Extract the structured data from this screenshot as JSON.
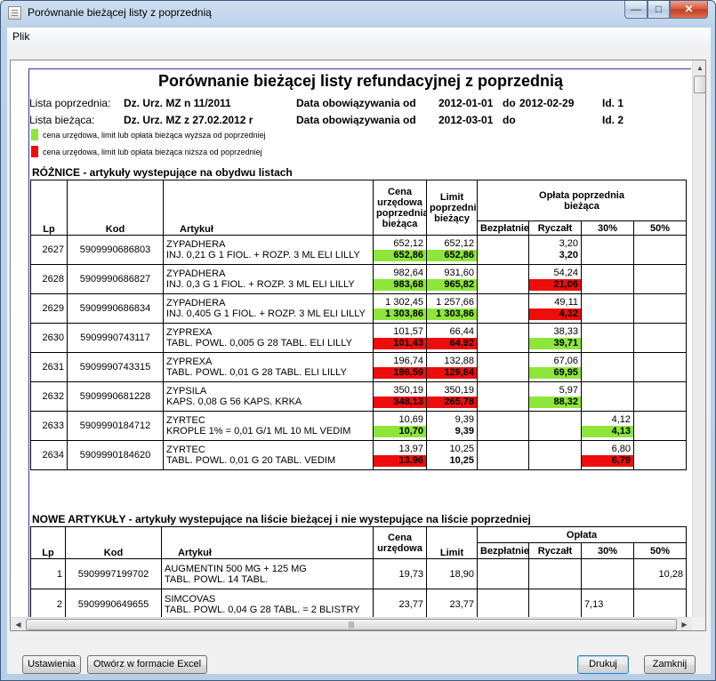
{
  "window": {
    "title": "Porównanie bieżącej listy z poprzednią"
  },
  "menu": {
    "file": "Plik"
  },
  "report": {
    "title": "Porównanie bieżącej listy refundacyjnej z poprzednią",
    "prev": {
      "label": "Lista poprzednia:",
      "name": "Dz. Urz. MZ n 11/2011",
      "validity_label": "Data obowiązywania od",
      "from": "2012-01-01",
      "to_label": "do",
      "to": "2012-02-29",
      "id": "Id. 1"
    },
    "curr": {
      "label": "Lista bieżąca:",
      "name": "Dz. Urz. MZ z 27.02.2012 r",
      "validity_label": "Data obowiązywania od",
      "from": "2012-03-01",
      "to_label": "do",
      "to": "",
      "id": "Id. 2"
    },
    "legend": {
      "higher": "cena urzędowa, limit lub opłata bieżąca wyższa od poprzedniej",
      "lower": "cena urzędowa, limit lub opłata bieżąca niższa od poprzedniej",
      "higher_color": "#8ee63a",
      "lower_color": "#ee0d0d"
    },
    "diff": {
      "section_title": "RÓŻNICE - artykuły wystepujące na obydwu listach",
      "headers": {
        "lp": "Lp",
        "kod": "Kod",
        "artykul": "Artykuł",
        "cena": "Cena urzędowa poprzednia bieżąca",
        "limit": "Limit poprzedni bieżący",
        "oplata": "Opłata poprzednia bieżąca",
        "bezplatnie": "Bezpłatnie",
        "ryczalt": "Ryczałt",
        "p30": "30%",
        "p50": "50%"
      },
      "rows": [
        {
          "lp": "2627",
          "kod": "5909990686803",
          "name": "ZYPADHERA",
          "desc": "INJ. 0,21 G 1 FIOL. + ROZP. 3 ML ELI LILLY",
          "cena_prev": "652,12",
          "cena_curr": "652,86",
          "cena_c": "g",
          "limit_prev": "652,12",
          "limit_curr": "652,86",
          "limit_c": "g",
          "ry_prev": "3,20",
          "ry_curr": "3,20",
          "ry_c": "",
          "p30_prev": "",
          "p30_curr": "",
          "p30_c": ""
        },
        {
          "lp": "2628",
          "kod": "5909990686827",
          "name": "ZYPADHERA",
          "desc": "INJ. 0,3 G 1 FIOL. + ROZP. 3 ML ELI LILLY",
          "cena_prev": "982,64",
          "cena_curr": "983,68",
          "cena_c": "g",
          "limit_prev": "931,60",
          "limit_curr": "965,82",
          "limit_c": "g",
          "ry_prev": "54,24",
          "ry_curr": "21,06",
          "ry_c": "red",
          "p30_prev": "",
          "p30_curr": "",
          "p30_c": ""
        },
        {
          "lp": "2629",
          "kod": "5909990686834",
          "name": "ZYPADHERA",
          "desc": "INJ. 0,405 G 1 FIOL. + ROZP. 3 ML ELI LILLY",
          "cena_prev": "1 302,45",
          "cena_curr": "1 303,86",
          "cena_c": "g",
          "limit_prev": "1 257,66",
          "limit_curr": "1 303,86",
          "limit_c": "g",
          "ry_prev": "49,11",
          "ry_curr": "4,32",
          "ry_c": "red",
          "p30_prev": "",
          "p30_curr": "",
          "p30_c": ""
        },
        {
          "lp": "2630",
          "kod": "5909990743117",
          "name": "ZYPREXA",
          "desc": "TABL. POWL. 0,005 G 28 TABL. ELI LILLY",
          "cena_prev": "101,57",
          "cena_curr": "101,43",
          "cena_c": "red",
          "limit_prev": "66,44",
          "limit_curr": "64,92",
          "limit_c": "red",
          "ry_prev": "38,33",
          "ry_curr": "39,71",
          "ry_c": "g",
          "p30_prev": "",
          "p30_curr": "",
          "p30_c": ""
        },
        {
          "lp": "2631",
          "kod": "5909990743315",
          "name": "ZYPREXA",
          "desc": "TABL. POWL. 0,01 G 28 TABL. ELI LILLY",
          "cena_prev": "196,74",
          "cena_curr": "196,59",
          "cena_c": "red",
          "limit_prev": "132,88",
          "limit_curr": "129,84",
          "limit_c": "red",
          "ry_prev": "67,06",
          "ry_curr": "69,95",
          "ry_c": "g",
          "p30_prev": "",
          "p30_curr": "",
          "p30_c": ""
        },
        {
          "lp": "2632",
          "kod": "5909990681228",
          "name": "ZYPSILA",
          "desc": "KAPS. 0,08 G 56 KAPS. KRKA",
          "cena_prev": "350,19",
          "cena_curr": "348,13",
          "cena_c": "red",
          "limit_prev": "350,19",
          "limit_curr": "265,78",
          "limit_c": "red",
          "ry_prev": "5,97",
          "ry_curr": "88,32",
          "ry_c": "g",
          "p30_prev": "",
          "p30_curr": "",
          "p30_c": ""
        },
        {
          "lp": "2633",
          "kod": "5909990184712",
          "name": "ZYRTEC",
          "desc": "KROPLE 1% = 0,01 G/1 ML 10 ML VEDIM",
          "cena_prev": "10,69",
          "cena_curr": "10,70",
          "cena_c": "g",
          "limit_prev": "9,39",
          "limit_curr": "9,39",
          "limit_c": "",
          "ry_prev": "",
          "ry_curr": "",
          "ry_c": "",
          "p30_prev": "4,12",
          "p30_curr": "4,13",
          "p30_c": "g"
        },
        {
          "lp": "2634",
          "kod": "5909990184620",
          "name": "ZYRTEC",
          "desc": "TABL. POWL. 0,01 G 20 TABL. VEDIM",
          "cena_prev": "13,97",
          "cena_curr": "13,96",
          "cena_c": "red",
          "limit_prev": "10,25",
          "limit_curr": "10,25",
          "limit_c": "",
          "ry_prev": "",
          "ry_curr": "",
          "ry_c": "",
          "p30_prev": "6,80",
          "p30_curr": "6,79",
          "p30_c": "red"
        }
      ]
    },
    "new": {
      "section_title": "NOWE ARTYKUŁY - artykuły wystepujące na liście bieżącej i nie wystepujące na liście poprzedniej",
      "headers": {
        "lp": "Lp",
        "kod": "Kod",
        "artykul": "Artykuł",
        "cena": "Cena urzędowa",
        "limit": "Limit",
        "oplata": "Opłata",
        "bezplatnie": "Bezpłatnie",
        "ryczalt": "Ryczałt",
        "p30": "30%",
        "p50": "50%"
      },
      "rows": [
        {
          "lp": "1",
          "kod": "5909997199702",
          "name": "AUGMENTIN 500 MG + 125 MG",
          "desc": "TABL. POWL.  14 TABL.",
          "cena": "19,73",
          "limit": "18,90",
          "bez": "",
          "ry": "",
          "p30": "",
          "p50": "10,28"
        },
        {
          "lp": "2",
          "kod": "5909990649655",
          "name": "SIMCOVAS",
          "desc": "TABL. POWL. 0,04 G 28 TABL. = 2 BLISTRY",
          "cena": "23,77",
          "limit": "23,77",
          "bez": "",
          "ry": "",
          "p30": "7,13",
          "p50": ""
        }
      ]
    }
  },
  "buttons": {
    "settings": "Ustawienia",
    "excel": "Otwórz w formacie Excel",
    "print": "Drukuj",
    "close": "Zamknij"
  }
}
